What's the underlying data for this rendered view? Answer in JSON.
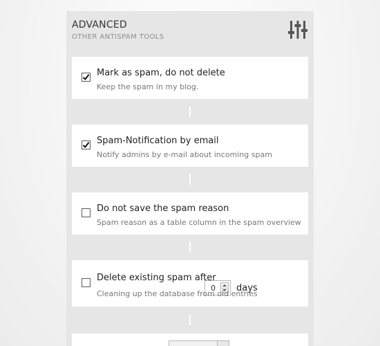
{
  "panel": {
    "title": "ADVANCED",
    "subtitle": "OTHER ANTISPAM TOOLS",
    "icon": "sliders-icon"
  },
  "options": [
    {
      "title": "Mark as spam, do not delete",
      "description": "Keep the spam in my blog.",
      "checked": true
    },
    {
      "title": "Spam-Notification by email",
      "description": "Notify admins by e-mail about incoming spam",
      "checked": true
    },
    {
      "title": "Do not save the spam reason",
      "description": "Spam reason as a table column in the spam overview",
      "checked": false
    },
    {
      "title": "Delete existing spam after",
      "description": "Cleaning up the database from old entries",
      "checked": false,
      "stepper_value": "0",
      "unit_label": "days"
    }
  ],
  "colors": {
    "panel_bg": "#e6e6e6",
    "card_bg": "#ffffff",
    "title_text": "#222222",
    "description_text": "#777777"
  }
}
